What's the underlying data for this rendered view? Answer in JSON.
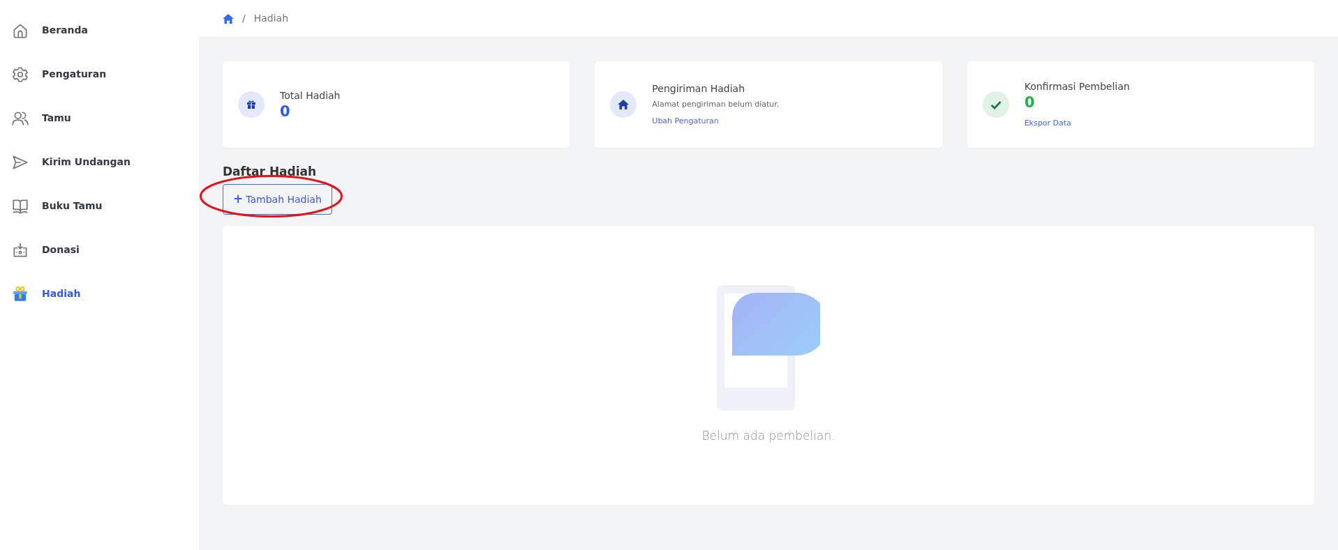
{
  "sidebar": {
    "items": [
      {
        "label": "Beranda",
        "selected": false
      },
      {
        "label": "Pengaturan",
        "selected": false
      },
      {
        "label": "Tamu",
        "selected": false
      },
      {
        "label": "Kirim Undangan",
        "selected": false
      },
      {
        "label": "Buku Tamu",
        "selected": false
      },
      {
        "label": "Donasi",
        "selected": false
      },
      {
        "label": "Hadiah",
        "selected": true
      }
    ]
  },
  "breadcrumb": {
    "separator": "/",
    "current": "Hadiah"
  },
  "stat_cards": [
    {
      "title": "Total Hadiah",
      "value": "0",
      "color": "#2f5be7"
    },
    {
      "title": "Pengiriman Hadiah",
      "note": "Alamat pengiriman belum diatur.",
      "link": "Ubah Pengaturan"
    },
    {
      "title": "Konfirmasi Pembelian",
      "value": "0",
      "color": "#22b04b",
      "link": "Ekspor Data"
    }
  ],
  "section": {
    "title": "Daftar Hadiah",
    "add_button": {
      "icon": "+",
      "label": "Tambah Hadiah"
    }
  },
  "empty_state": {
    "message": "Belum ada pembelian."
  }
}
